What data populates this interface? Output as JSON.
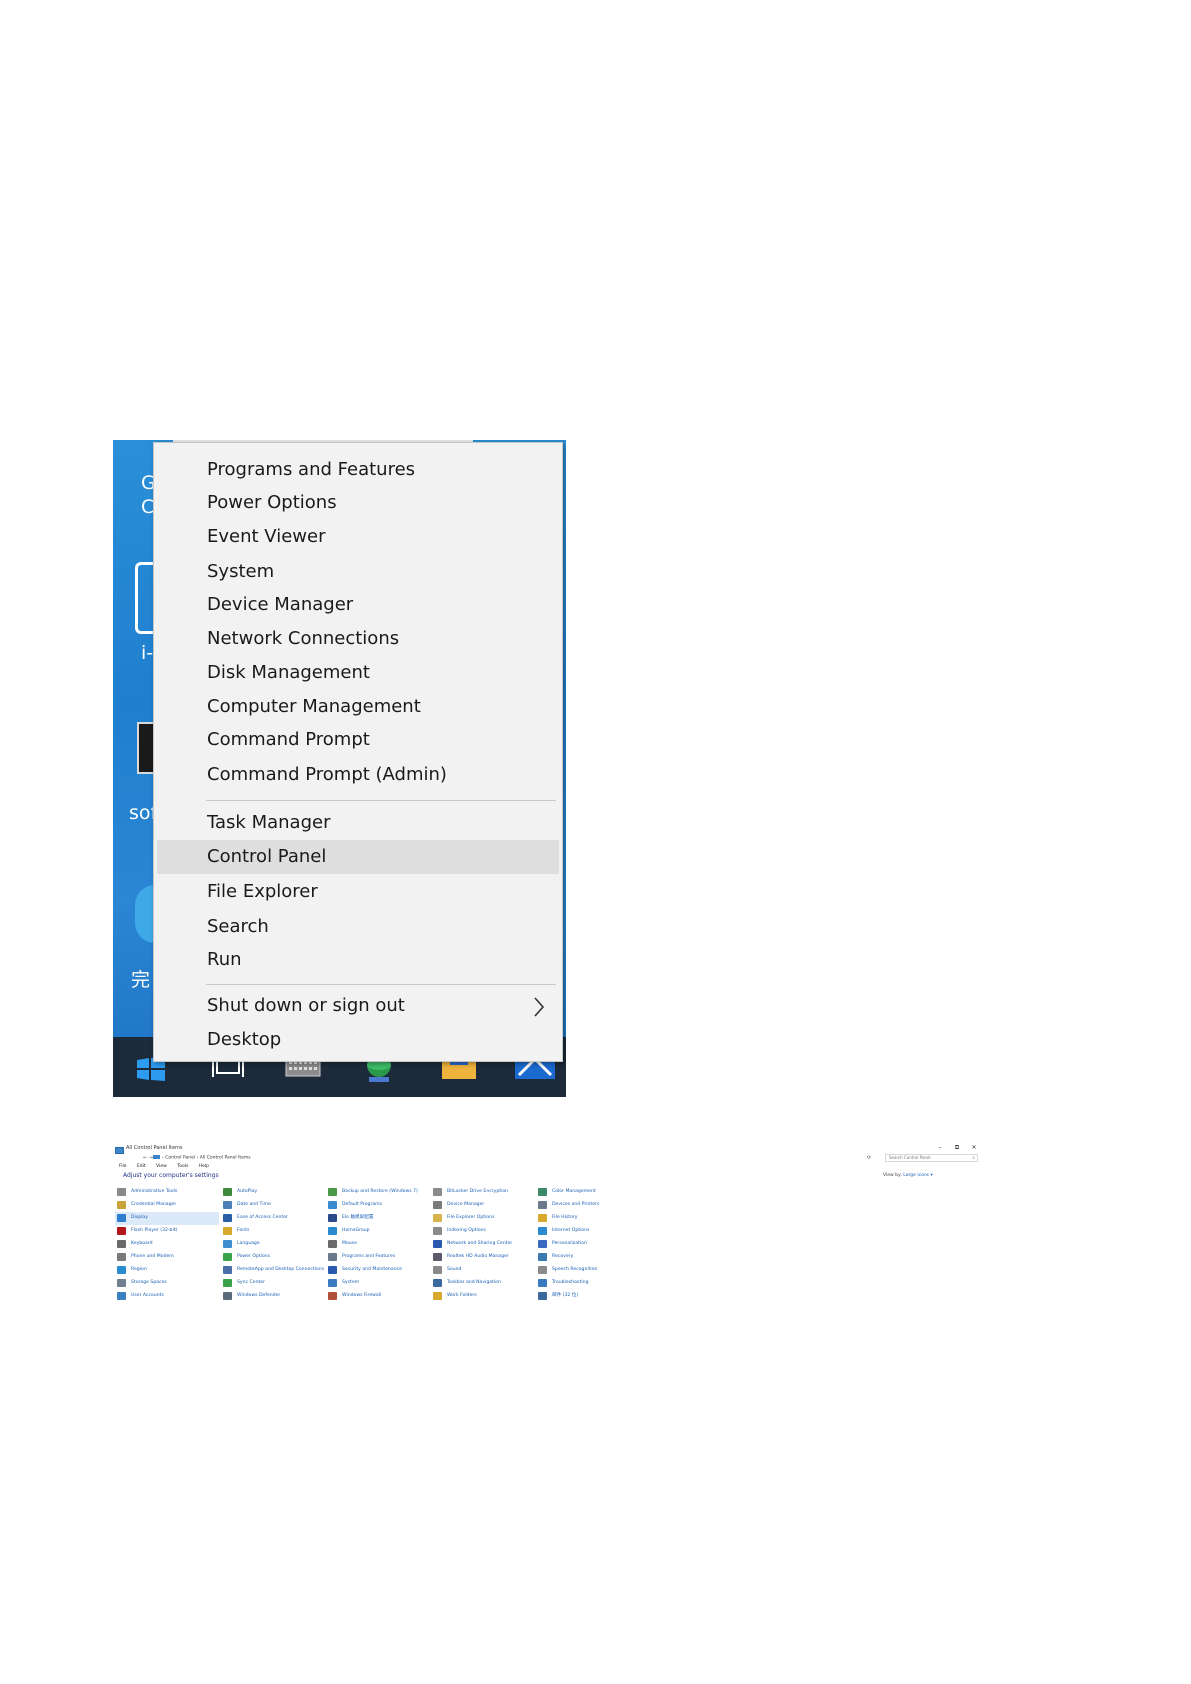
{
  "winx_menu": {
    "items": [
      {
        "label": "Programs and Features"
      },
      {
        "label": "Power Options"
      },
      {
        "label": "Event Viewer"
      },
      {
        "label": "System"
      },
      {
        "label": "Device Manager"
      },
      {
        "label": "Network Connections"
      },
      {
        "label": "Disk Management"
      },
      {
        "label": "Computer Management"
      },
      {
        "label": "Command Prompt"
      },
      {
        "label": "Command Prompt (Admin)"
      },
      {
        "label": "Task Manager"
      },
      {
        "label": "Control Panel",
        "highlighted": true
      },
      {
        "label": "File Explorer"
      },
      {
        "label": "Search"
      },
      {
        "label": "Run"
      },
      {
        "label": "Shut down or sign out",
        "has_submenu": true
      },
      {
        "label": "Desktop"
      }
    ]
  },
  "desktop": {
    "fragments": [
      "G",
      "C",
      "i-",
      "sof",
      "完"
    ]
  },
  "control_panel": {
    "window_title": "All Control Panel Items",
    "window_buttons": [
      "–",
      "⧉",
      "✕"
    ],
    "nav": "← → ↑",
    "breadcrumb": [
      "Control Panel",
      "All Control Panel Items"
    ],
    "breadcrumb_sep": "›",
    "search_placeholder": "Search Control Panel",
    "menu": [
      "File",
      "Edit",
      "View",
      "Tools",
      "Help"
    ],
    "heading": "Adjust your computer's settings",
    "view_by_label": "View by:",
    "view_by_value": "Large icons ▾",
    "columns": [
      [
        {
          "label": "Administrative Tools",
          "color": "#8a8a8a"
        },
        {
          "label": "Credential Manager",
          "color": "#c9a23a"
        },
        {
          "label": "Display",
          "color": "#2f7fd0",
          "selected": true
        },
        {
          "label": "Flash Player (32-bit)",
          "color": "#b3161b"
        },
        {
          "label": "Keyboard",
          "color": "#6a6a6a"
        },
        {
          "label": "Phone and Modem",
          "color": "#7a7a7a"
        },
        {
          "label": "Region",
          "color": "#2a8bd1"
        },
        {
          "label": "Storage Spaces",
          "color": "#6f7f8f"
        },
        {
          "label": "User Accounts",
          "color": "#3a7fc0"
        }
      ],
      [
        {
          "label": "AutoPlay",
          "color": "#3d8a3d"
        },
        {
          "label": "Date and Time",
          "color": "#4a7fb8"
        },
        {
          "label": "Ease of Access Center",
          "color": "#2b5fa8"
        },
        {
          "label": "Fonts",
          "color": "#d8a92c"
        },
        {
          "label": "Language",
          "color": "#3e8ed0"
        },
        {
          "label": "Power Options",
          "color": "#3aa34a"
        },
        {
          "label": "RemoteApp and Desktop Connections",
          "color": "#4a6fa8"
        },
        {
          "label": "Sync Center",
          "color": "#3aa34a"
        },
        {
          "label": "Windows Defender",
          "color": "#5b6b7b"
        }
      ],
      [
        {
          "label": "Backup and Restore (Windows 7)",
          "color": "#4a9a4a"
        },
        {
          "label": "Default Programs",
          "color": "#3a8ad0"
        },
        {
          "label": "Elo 触摸屏配置",
          "color": "#2a4a8a"
        },
        {
          "label": "HomeGroup",
          "color": "#2a8ad0"
        },
        {
          "label": "Mouse",
          "color": "#6a6a6a"
        },
        {
          "label": "Programs and Features",
          "color": "#6a7a8a"
        },
        {
          "label": "Security and Maintenance",
          "color": "#2a5ab0"
        },
        {
          "label": "System",
          "color": "#3a7ac0"
        },
        {
          "label": "Windows Firewall",
          "color": "#b0503a"
        }
      ],
      [
        {
          "label": "BitLocker Drive Encryption",
          "color": "#8a8a8a"
        },
        {
          "label": "Device Manager",
          "color": "#7a7a7a"
        },
        {
          "label": "File Explorer Options",
          "color": "#d8b24a"
        },
        {
          "label": "Indexing Options",
          "color": "#8a8a8a"
        },
        {
          "label": "Network and Sharing Center",
          "color": "#2a5ab0"
        },
        {
          "label": "Realtek HD Audio Manager",
          "color": "#5a5a6a"
        },
        {
          "label": "Sound",
          "color": "#8a8a8a"
        },
        {
          "label": "Taskbar and Navigation",
          "color": "#3a6aa0"
        },
        {
          "label": "Work Folders",
          "color": "#d8a92c"
        }
      ],
      [
        {
          "label": "Color Management",
          "color": "#3a8a6a"
        },
        {
          "label": "Devices and Printers",
          "color": "#6a7a8a"
        },
        {
          "label": "File History",
          "color": "#d8a92c"
        },
        {
          "label": "Internet Options",
          "color": "#2a8ad0"
        },
        {
          "label": "Personalization",
          "color": "#3a6ac0"
        },
        {
          "label": "Recovery",
          "color": "#3a7ab0"
        },
        {
          "label": "Speech Recognition",
          "color": "#8a8a8a"
        },
        {
          "label": "Troubleshooting",
          "color": "#3a7ac0"
        },
        {
          "label": "邮件 (32 位)",
          "color": "#3a6aa0"
        }
      ]
    ]
  }
}
